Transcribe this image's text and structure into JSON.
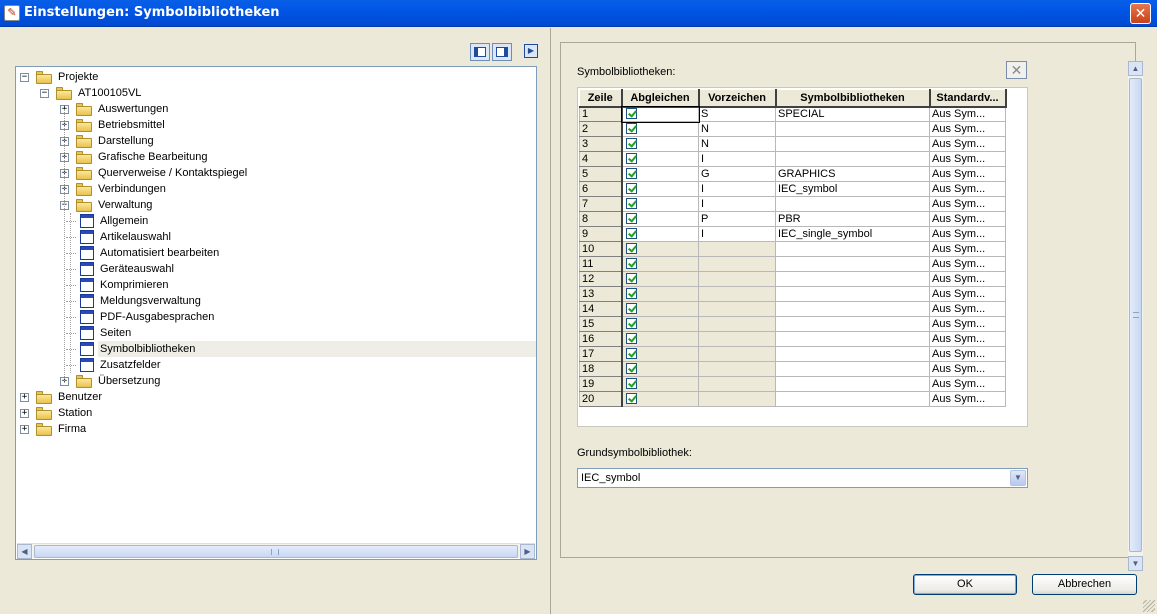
{
  "window": {
    "title": "Einstellungen: Symbolbibliotheken",
    "close_glyph": "✕"
  },
  "tree": {
    "nodes": [
      {
        "label": "Projekte",
        "level": 0,
        "type": "folder",
        "expander": "-"
      },
      {
        "label": "AT100105VL",
        "level": 1,
        "type": "folder",
        "expander": "-"
      },
      {
        "label": "Auswertungen",
        "level": 2,
        "type": "folder",
        "expander": "+"
      },
      {
        "label": "Betriebsmittel",
        "level": 2,
        "type": "folder",
        "expander": "+"
      },
      {
        "label": "Darstellung",
        "level": 2,
        "type": "folder",
        "expander": "+"
      },
      {
        "label": "Grafische Bearbeitung",
        "level": 2,
        "type": "folder",
        "expander": "+"
      },
      {
        "label": "Querverweise / Kontaktspiegel",
        "level": 2,
        "type": "folder",
        "expander": "+"
      },
      {
        "label": "Verbindungen",
        "level": 2,
        "type": "folder",
        "expander": "+"
      },
      {
        "label": "Verwaltung",
        "level": 2,
        "type": "folder",
        "expander": "-"
      },
      {
        "label": "Allgemein",
        "level": 3,
        "type": "page"
      },
      {
        "label": "Artikelauswahl",
        "level": 3,
        "type": "page"
      },
      {
        "label": "Automatisiert bearbeiten",
        "level": 3,
        "type": "page"
      },
      {
        "label": "Geräteauswahl",
        "level": 3,
        "type": "page"
      },
      {
        "label": "Komprimieren",
        "level": 3,
        "type": "page"
      },
      {
        "label": "Meldungsverwaltung",
        "level": 3,
        "type": "page"
      },
      {
        "label": "PDF-Ausgabesprachen",
        "level": 3,
        "type": "page"
      },
      {
        "label": "Seiten",
        "level": 3,
        "type": "page"
      },
      {
        "label": "Symbolbibliotheken",
        "level": 3,
        "type": "page",
        "selected": true
      },
      {
        "label": "Zusatzfelder",
        "level": 3,
        "type": "page"
      },
      {
        "label": "Übersetzung",
        "level": 2,
        "type": "folder",
        "expander": "+"
      },
      {
        "label": "Benutzer",
        "level": 0,
        "type": "folder",
        "expander": "+"
      },
      {
        "label": "Station",
        "level": 0,
        "type": "folder",
        "expander": "+"
      },
      {
        "label": "Firma",
        "level": 0,
        "type": "folder",
        "expander": "+"
      }
    ]
  },
  "settings": {
    "symlib_label": "Symbolbibliotheken:",
    "columns": [
      "Zeile",
      "Abgleichen",
      "Vorzeichen",
      "Symbolbibliotheken",
      "Standardv..."
    ],
    "rows": [
      {
        "zeile": "1",
        "vorzeichen": "S",
        "lib": "SPECIAL",
        "std": "Aus Sym..."
      },
      {
        "zeile": "2",
        "vorzeichen": "N",
        "lib": "",
        "std": "Aus Sym..."
      },
      {
        "zeile": "3",
        "vorzeichen": "N",
        "lib": "",
        "std": "Aus Sym..."
      },
      {
        "zeile": "4",
        "vorzeichen": "I",
        "lib": "",
        "std": "Aus Sym..."
      },
      {
        "zeile": "5",
        "vorzeichen": "G",
        "lib": "GRAPHICS",
        "std": "Aus Sym..."
      },
      {
        "zeile": "6",
        "vorzeichen": "I",
        "lib": "IEC_symbol",
        "std": "Aus Sym..."
      },
      {
        "zeile": "7",
        "vorzeichen": "I",
        "lib": "",
        "std": "Aus Sym..."
      },
      {
        "zeile": "8",
        "vorzeichen": "P",
        "lib": "PBR",
        "std": "Aus Sym..."
      },
      {
        "zeile": "9",
        "vorzeichen": "I",
        "lib": "IEC_single_symbol",
        "std": "Aus Sym..."
      },
      {
        "zeile": "10",
        "vorzeichen": "",
        "lib": "",
        "std": "Aus Sym..."
      },
      {
        "zeile": "11",
        "vorzeichen": "",
        "lib": "",
        "std": "Aus Sym..."
      },
      {
        "zeile": "12",
        "vorzeichen": "",
        "lib": "",
        "std": "Aus Sym..."
      },
      {
        "zeile": "13",
        "vorzeichen": "",
        "lib": "",
        "std": "Aus Sym..."
      },
      {
        "zeile": "14",
        "vorzeichen": "",
        "lib": "",
        "std": "Aus Sym..."
      },
      {
        "zeile": "15",
        "vorzeichen": "",
        "lib": "",
        "std": "Aus Sym..."
      },
      {
        "zeile": "16",
        "vorzeichen": "",
        "lib": "",
        "std": "Aus Sym..."
      },
      {
        "zeile": "17",
        "vorzeichen": "",
        "lib": "",
        "std": "Aus Sym..."
      },
      {
        "zeile": "18",
        "vorzeichen": "",
        "lib": "",
        "std": "Aus Sym..."
      },
      {
        "zeile": "19",
        "vorzeichen": "",
        "lib": "",
        "std": "Aus Sym..."
      },
      {
        "zeile": "20",
        "vorzeichen": "",
        "lib": "",
        "std": "Aus Sym..."
      }
    ],
    "grund_label": "Grundsymbolbibliothek:",
    "grund_value": "IEC_symbol"
  },
  "buttons": {
    "ok": "OK",
    "cancel": "Abbrechen"
  },
  "colors": {
    "titlebar": "#0055e5",
    "face": "#ece9d8",
    "check": "#21a121"
  }
}
